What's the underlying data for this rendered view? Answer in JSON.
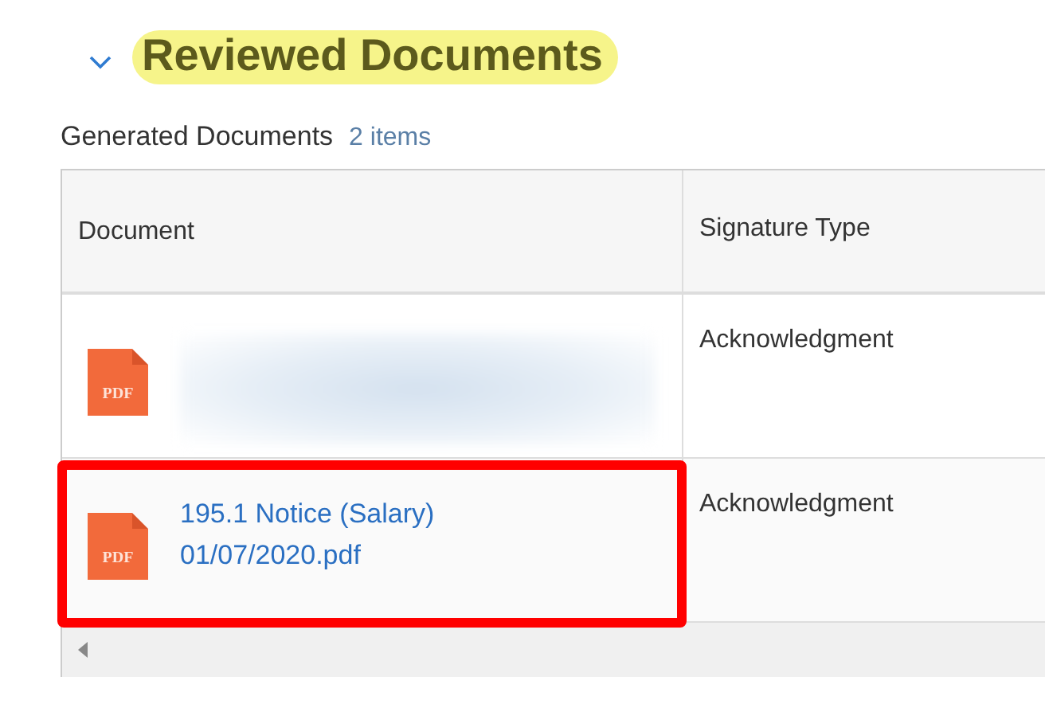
{
  "section": {
    "title": "Reviewed Documents",
    "expanded": true,
    "highlighted": true
  },
  "grid": {
    "title": "Generated Documents",
    "count": "2 items",
    "columns": [
      "Document",
      "Signature Type"
    ],
    "rows": [
      {
        "kind": "redacted",
        "icon_label": "PDF",
        "signature_type": "Acknowledgment",
        "highlighted": false
      },
      {
        "kind": "link",
        "icon_label": "PDF",
        "document": "195.1 Notice (Salary) 01/07/2020.pdf",
        "signature_type": "Acknowledgment",
        "highlighted": true
      }
    ]
  }
}
